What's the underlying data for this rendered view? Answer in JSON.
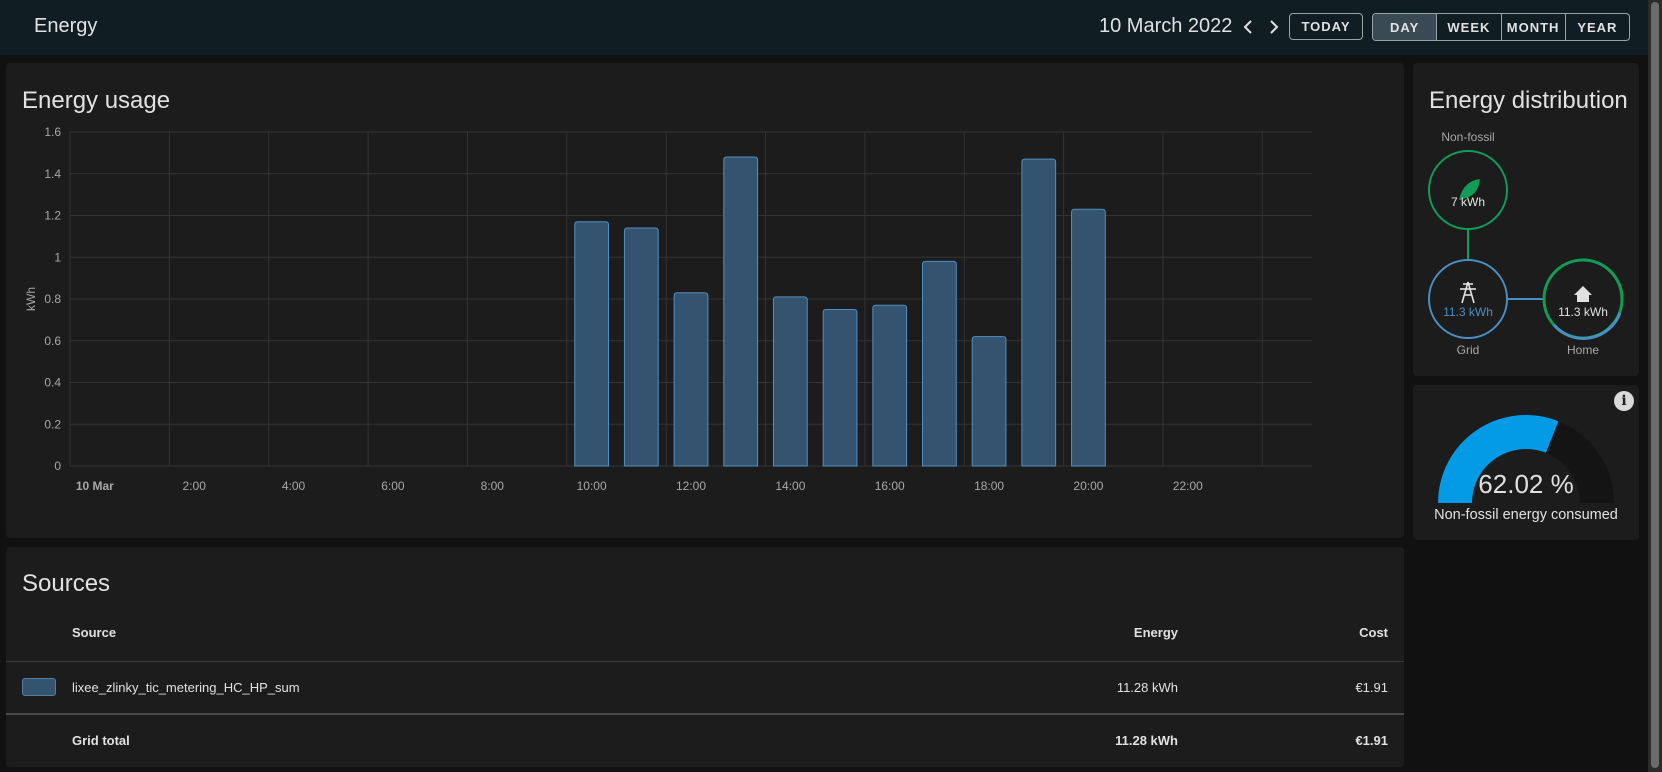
{
  "header": {
    "title": "Energy",
    "date": "10 March 2022",
    "today_label": "TODAY",
    "periods": [
      "DAY",
      "WEEK",
      "MONTH",
      "YEAR"
    ],
    "active_period": "DAY"
  },
  "energy_usage": {
    "title": "Energy usage"
  },
  "chart_data": {
    "type": "bar",
    "ylabel": "kWh",
    "ylim": [
      0,
      1.6
    ],
    "yticks": [
      "0",
      "0.2",
      "0.4",
      "0.6",
      "0.8",
      "1",
      "1.2",
      "1.4",
      "1.6"
    ],
    "xticks": [
      "10 Mar",
      "2:00",
      "4:00",
      "6:00",
      "8:00",
      "10:00",
      "12:00",
      "14:00",
      "16:00",
      "18:00",
      "20:00",
      "22:00"
    ],
    "hours": [
      10,
      11,
      12,
      13,
      14,
      15,
      16,
      17,
      18,
      19,
      20
    ],
    "values": [
      1.17,
      1.14,
      0.83,
      1.48,
      0.81,
      0.75,
      0.77,
      0.98,
      0.62,
      1.47,
      1.23
    ],
    "bar_fill": "#34536e",
    "bar_stroke": "#4f8fc4",
    "grid": true
  },
  "distribution": {
    "title": "Energy distribution",
    "non_fossil": {
      "label": "Non-fossil",
      "value": "7 kWh",
      "color": "#0f9d58"
    },
    "grid": {
      "label": "Grid",
      "value": "11.3 kWh",
      "color": "#488fc2"
    },
    "home": {
      "label": "Home",
      "value": "11.3 kWh",
      "color": "#e1e1e1"
    }
  },
  "gauge": {
    "value_text": "62.02 %",
    "value": 62.02,
    "label": "Non-fossil energy consumed",
    "color": "#039be5"
  },
  "sources": {
    "title": "Sources",
    "columns": {
      "source": "Source",
      "energy": "Energy",
      "cost": "Cost"
    },
    "rows": [
      {
        "name": "lixee_zlinky_tic_metering_HC_HP_sum",
        "energy": "11.28 kWh",
        "cost": "€1.91"
      }
    ],
    "total": {
      "name": "Grid total",
      "energy": "11.28 kWh",
      "cost": "€1.91"
    }
  }
}
